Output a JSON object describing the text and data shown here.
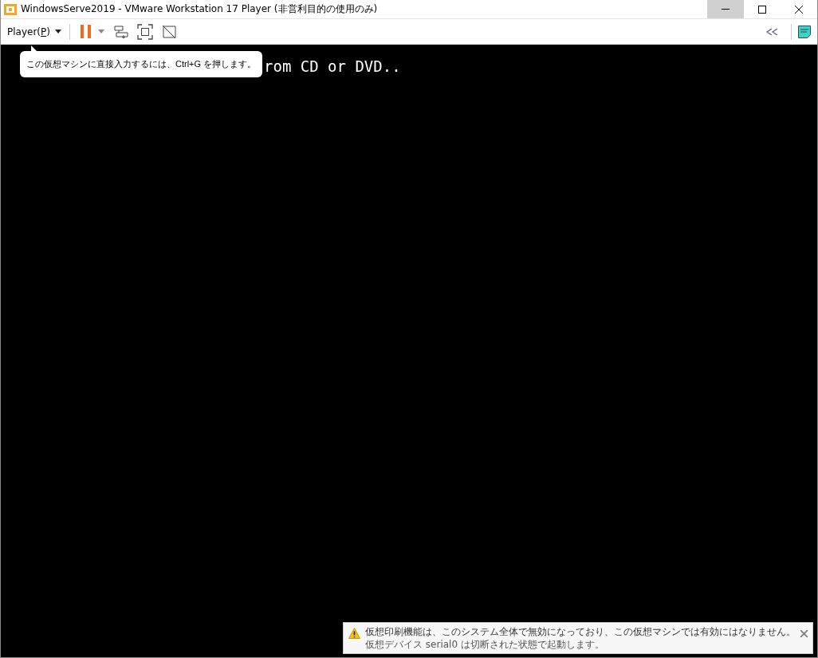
{
  "window": {
    "title": "WindowsServe2019 - VMware Workstation 17 Player (非営利目的の使用のみ)",
    "controls": [
      {
        "kind": "minimize",
        "highlighted": true
      },
      {
        "kind": "maximize",
        "highlighted": false
      },
      {
        "kind": "close",
        "highlighted": false
      }
    ]
  },
  "toolbar": {
    "menu_label_parts": [
      "Player(",
      "P",
      ")"
    ]
  },
  "console": {
    "line": "rom CD or DVD.."
  },
  "tooltip": {
    "text": "この仮想マシンに直接入力するには、Ctrl+G を押します。"
  },
  "notification": {
    "message": "仮想印刷機能は、このシステム全体で無効になっており、この仮想マシンでは有効にはなりません。",
    "detail": "仮想デバイス serial0 は切断された状態で起動します。"
  }
}
